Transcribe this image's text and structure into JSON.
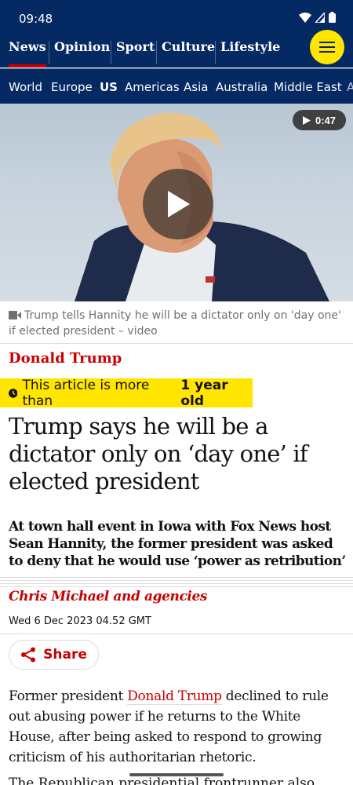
{
  "status_bar": {
    "time": "09:48"
  },
  "pillars": [
    {
      "label": "News",
      "active": true
    },
    {
      "label": "Opinion"
    },
    {
      "label": "Sport"
    },
    {
      "label": "Culture"
    },
    {
      "label": "Lifestyle"
    }
  ],
  "subnav": [
    "World",
    "Europe",
    "US",
    "Americas",
    "Asia",
    "Australia",
    "Middle East",
    "A"
  ],
  "video": {
    "duration": "0:47",
    "caption": "Trump tells Hannity he will be a dictator only on 'day one' if elected president – video"
  },
  "article": {
    "kicker": "Donald Trump",
    "age_notice": "This article is more than",
    "age_value": "1 year old",
    "headline": "Trump says he will be a dictator only on ‘day one’ if elected president",
    "standfirst": "At town hall event in Iowa with Fox News host Sean Hannity, the former president was asked to deny that he would use ‘power as retribution’",
    "byline": "Chris Michael and agencies",
    "date": "Wed 6 Dec 2023 04.52 GMT",
    "share_label": "Share",
    "body_start": "Former president ",
    "body_link": "Donald Trump",
    "body_rest": " declined to rule out abusing power if he returns to the White House, after being asked to respond to growing criticism of his authoritarian rhetoric.",
    "next_line": "The Republican presidential frontrunner also"
  },
  "colors": {
    "brand": "#052962",
    "accent": "#c70000",
    "highlight": "#ffe500"
  }
}
